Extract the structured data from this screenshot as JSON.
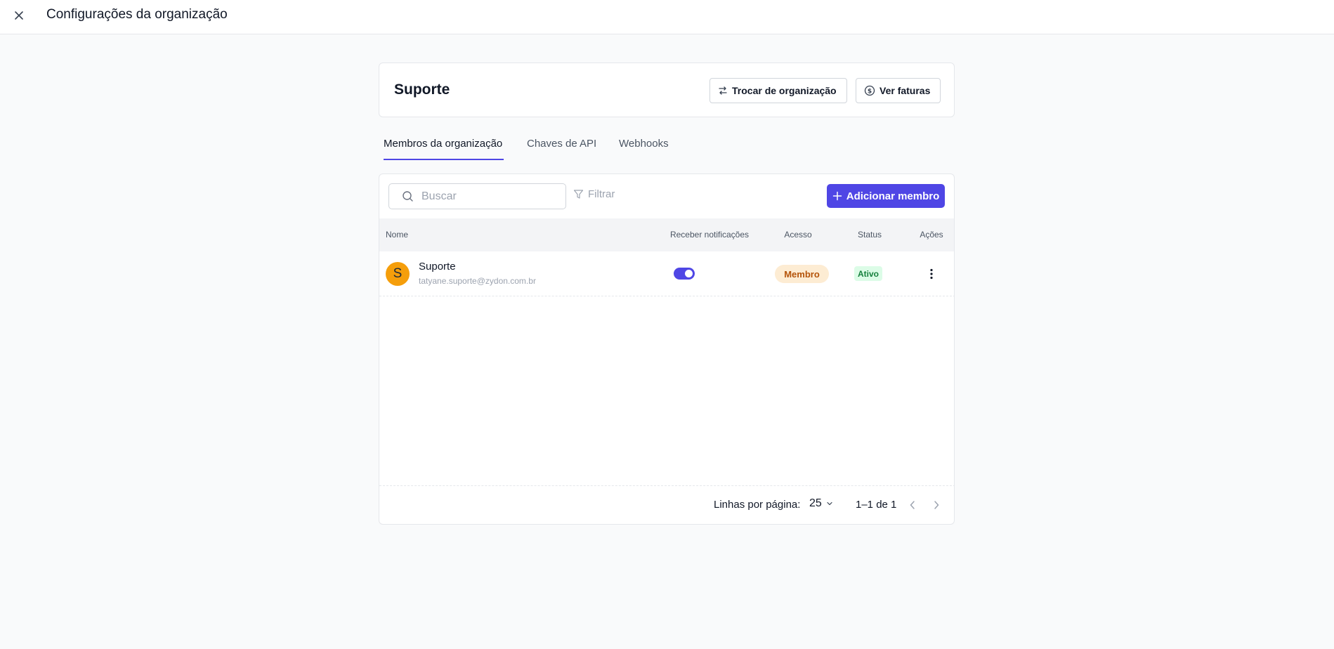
{
  "header": {
    "title": "Configurações da organização"
  },
  "org": {
    "name": "Suporte",
    "switch_label": "Trocar de organização",
    "invoices_label": "Ver faturas"
  },
  "tabs": [
    {
      "label": "Membros da organização",
      "active": true
    },
    {
      "label": "Chaves de API",
      "active": false
    },
    {
      "label": "Webhooks",
      "active": false
    }
  ],
  "toolbar": {
    "search_placeholder": "Buscar",
    "filter_label": "Filtrar",
    "add_member_label": "Adicionar membro"
  },
  "table": {
    "columns": [
      "Nome",
      "Receber notificações",
      "Acesso",
      "Status",
      "Ações"
    ],
    "rows": [
      {
        "avatar_initial": "S",
        "name": "Suporte",
        "email": "tatyane.suporte@zydon.com.br",
        "notifications": true,
        "access": "Membro",
        "status": "Ativo"
      }
    ]
  },
  "pagination": {
    "rows_per_page_label": "Linhas por página:",
    "rows_per_page": "25",
    "range": "1–1 de 1"
  },
  "colors": {
    "accent": "#4f46e5",
    "avatar": "#f59e0b",
    "role_badge_bg": "#fdecd3",
    "role_badge_text": "#b45309",
    "status_badge_bg": "#dcfce7",
    "status_badge_text": "#15803d"
  },
  "icons": {
    "close": "close-icon",
    "switch": "swap-icon",
    "invoices": "dollar-circle-icon",
    "search": "search-icon",
    "filter": "filter-icon",
    "add": "plus-icon",
    "actions": "kebab-vertical-icon",
    "prev": "chevron-left-icon",
    "next": "chevron-right-icon",
    "dropdown": "chevron-down-icon"
  }
}
